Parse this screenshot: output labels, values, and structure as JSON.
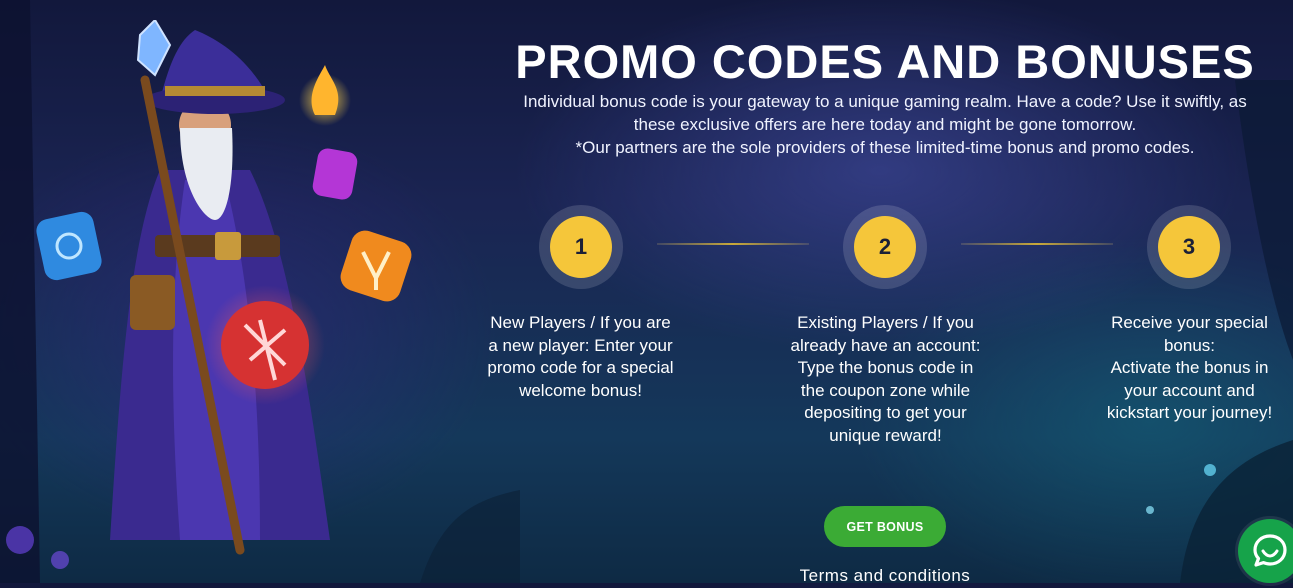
{
  "page": {
    "title": "PROMO CODES AND BONUSES",
    "subtitle_lines": [
      "Individual bonus code is your gateway to a unique gaming realm. Have a code? Use it swiftly, as",
      "these exclusive offers are here today and might be gone tomorrow.",
      "*Our partners are the sole providers of these limited-time bonus and promo codes."
    ]
  },
  "steps": [
    {
      "number": "1",
      "lines": [
        "New Players / If you are",
        "a new player: Enter your",
        "promo code for a special",
        "welcome bonus!"
      ]
    },
    {
      "number": "2",
      "lines": [
        "Existing Players / If you",
        "already have an account:",
        "Type the bonus code in",
        "the coupon zone while",
        "depositing to get your",
        "unique reward!"
      ]
    },
    {
      "number": "3",
      "lines": [
        "Receive your special",
        "bonus:",
        "Activate the bonus in",
        "your account and",
        "kickstart your journey!"
      ]
    }
  ],
  "actions": {
    "get_bonus_label": "GET BONUS",
    "terms_label": "Terms and conditions"
  },
  "icons": {
    "chat": "chat-bubble-icon"
  },
  "colors": {
    "accent_yellow": "#f5c63a",
    "button_green": "#3bab35",
    "chat_green": "#16a34a",
    "background_navy": "#1a2452"
  }
}
